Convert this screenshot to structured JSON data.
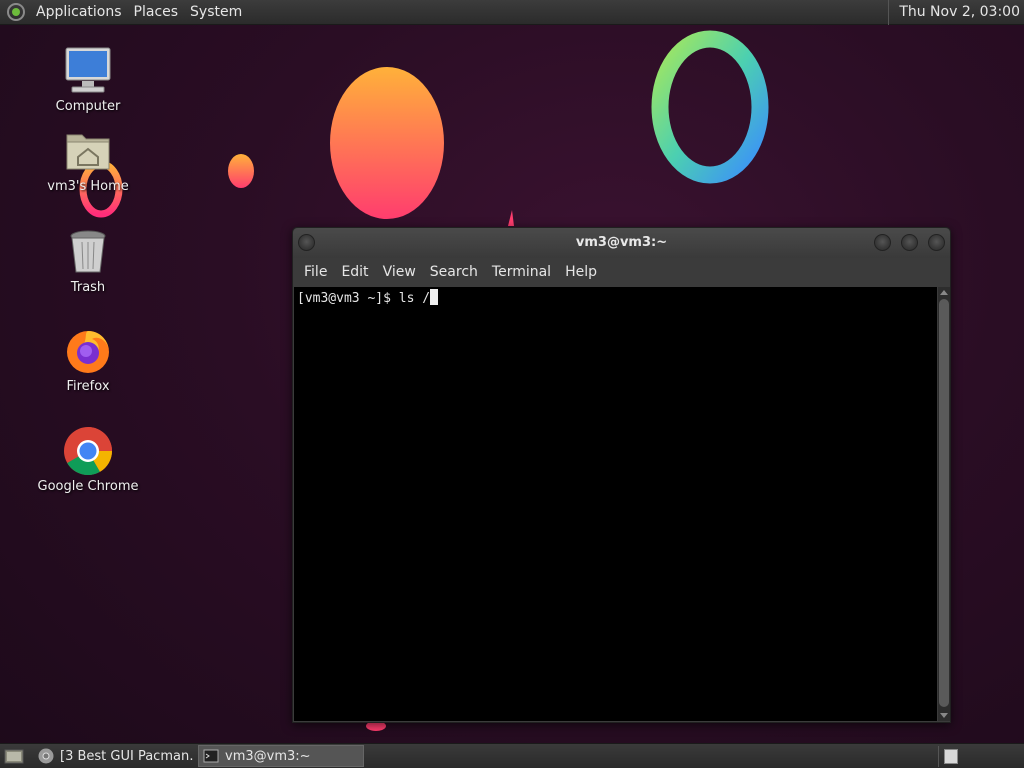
{
  "top_panel": {
    "menus": [
      "Applications",
      "Places",
      "System"
    ],
    "clock": "Thu Nov  2, 03:00"
  },
  "desktop": {
    "icons": [
      {
        "label": "Computer",
        "icon": "computer-icon"
      },
      {
        "label": "vm3's Home",
        "icon": "home-folder-icon"
      },
      {
        "label": "Trash",
        "icon": "trash-icon"
      },
      {
        "label": "Firefox",
        "icon": "firefox-icon"
      },
      {
        "label": "Google Chrome",
        "icon": "chrome-icon"
      }
    ]
  },
  "terminal": {
    "title": "vm3@vm3:~",
    "menu": [
      "File",
      "Edit",
      "View",
      "Search",
      "Terminal",
      "Help"
    ],
    "prompt": "[vm3@vm3 ~]$ ",
    "command": "ls /"
  },
  "taskbar": {
    "tasks": [
      {
        "label": "[3 Best GUI Pacman…",
        "icon": "chrome-icon",
        "active": false
      },
      {
        "label": "vm3@vm3:~",
        "icon": "terminal-icon",
        "active": true
      }
    ]
  },
  "colors": {
    "wallpaper": "#2a0d24",
    "panel": "#2f2f2f",
    "terminal_bg": "#000000"
  }
}
